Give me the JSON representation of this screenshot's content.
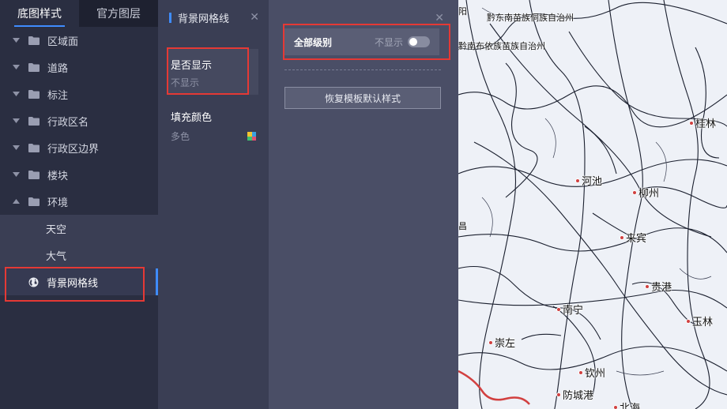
{
  "tabs": [
    {
      "label": "底图样式",
      "active": true
    },
    {
      "label": "官方图层",
      "active": false
    }
  ],
  "tree": {
    "items": [
      {
        "label": "区域面",
        "expanded": false
      },
      {
        "label": "道路",
        "expanded": false
      },
      {
        "label": "标注",
        "expanded": false
      },
      {
        "label": "行政区名",
        "expanded": false
      },
      {
        "label": "行政区边界",
        "expanded": false
      },
      {
        "label": "楼块",
        "expanded": false
      },
      {
        "label": "环境",
        "expanded": true
      }
    ],
    "environment_children": [
      "天空",
      "大气"
    ],
    "selected": {
      "label": "背景网格线",
      "icon": "globe-icon"
    }
  },
  "panel2": {
    "title": "背景网格线",
    "visibility": {
      "title": "是否显示",
      "value": "不显示"
    },
    "fill": {
      "title": "填充颜色",
      "value": "多色"
    }
  },
  "panel3": {
    "level_label": "全部级别",
    "level_state": "不显示",
    "toggle_on": false,
    "reset_label": "恢复模板默认样式"
  },
  "map": {
    "top_labels": [
      "阳",
      "黔东南苗族侗族自治州",
      "黔南布依族苗族自治州"
    ],
    "edge_label": "昌",
    "cities": [
      "桂林",
      "河池",
      "柳州",
      "来宾",
      "贵港",
      "南宁",
      "玉林",
      "崇左",
      "钦州",
      "防城港",
      "北海"
    ]
  },
  "colors": {
    "accent": "#3f8cff",
    "highlight": "#e53935",
    "sidebar_bg": "#2a2e41",
    "panel2_bg": "#3a3e54",
    "panel3_bg": "#4a4e66",
    "map_bg": "#eef1f7"
  }
}
